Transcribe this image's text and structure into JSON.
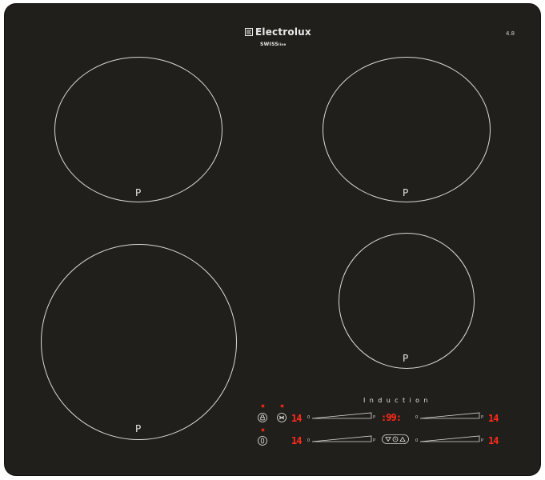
{
  "brand": {
    "name": "Electrolux",
    "logo_icon": "electrolux-logo-icon",
    "sub_brand": "SWISS",
    "sub_brand_small": "line"
  },
  "model_code": "4.8",
  "zones": [
    {
      "name": "rear-left",
      "label": "P"
    },
    {
      "name": "rear-right",
      "label": "P"
    },
    {
      "name": "front-left",
      "label": "P"
    },
    {
      "name": "front-right",
      "label": "P"
    }
  ],
  "panel": {
    "induction_label": "Induction",
    "lock_icon": "lock-icon",
    "stopgo_icon": "stop-go-icon",
    "power_icon": "power-icon",
    "timer_display": "99",
    "timer_icons": [
      "down-arrow-icon",
      "clock-icon",
      "up-arrow-icon"
    ],
    "led_color": "#ff2a1a",
    "sliders": [
      {
        "name": "front-left",
        "display": "14",
        "min": "0",
        "max": "P"
      },
      {
        "name": "rear-left",
        "display": "14",
        "min": "0",
        "max": "P"
      },
      {
        "name": "rear-right",
        "display": "14",
        "min": "0",
        "max": "P"
      },
      {
        "name": "front-right",
        "display": "14",
        "min": "0",
        "max": "P"
      }
    ]
  }
}
